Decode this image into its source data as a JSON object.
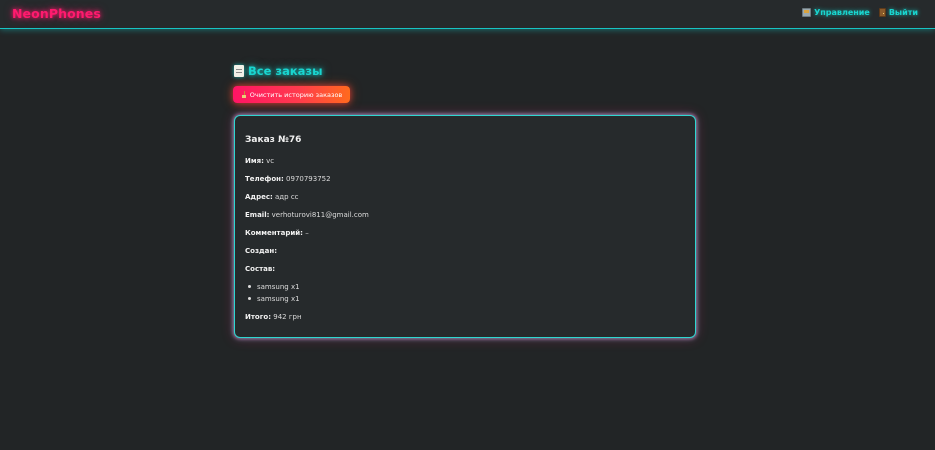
{
  "header": {
    "brand": "NeonPhones",
    "nav": [
      {
        "label": "Управление",
        "icon": "control-panel-icon"
      },
      {
        "label": "Выйти",
        "icon": "door-icon"
      }
    ]
  },
  "page": {
    "title": "Все заказы",
    "title_icon": "scroll-icon",
    "clear_button": "Очистить историю заказов",
    "clear_icon": "broom-icon"
  },
  "order": {
    "title": "Заказ №76",
    "name_label": "Имя:",
    "name_value": "vc",
    "phone_label": "Телефон:",
    "phone_value": "0970793752",
    "address_label": "Адрес:",
    "address_value": "адр сс",
    "email_label": "Email:",
    "email_value": "verhoturovi811@gmail.com",
    "comment_label": "Комментарий:",
    "comment_value": "–",
    "created_label": "Создан:",
    "created_value": "",
    "items_label": "Состав:",
    "items": [
      "samsung x1",
      "samsung x1"
    ],
    "total_label": "Итого:",
    "total_value": "942 грн"
  },
  "colors": {
    "background": "#222526",
    "accent_cyan": "#19d6d0",
    "accent_pink": "#ff1a6e",
    "button_orange": "#ff6a1e"
  }
}
